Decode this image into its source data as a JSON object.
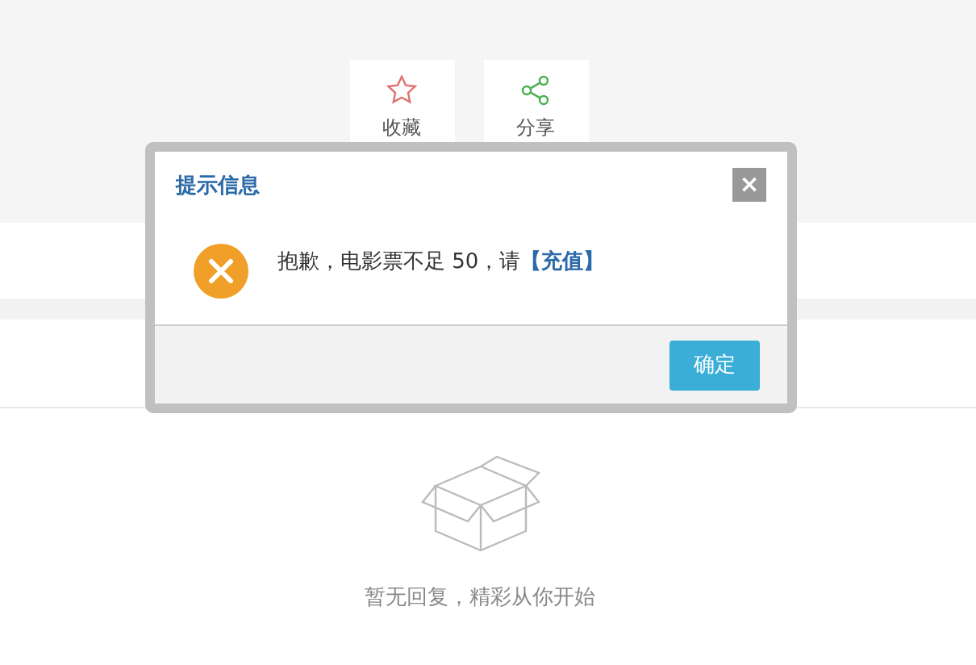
{
  "actions": [
    {
      "kind": "favorite",
      "label": "收藏"
    },
    {
      "kind": "share",
      "label": "分享"
    }
  ],
  "empty_state": {
    "text": "暂无回复，精彩从你开始"
  },
  "dialog": {
    "title": "提示信息",
    "close": "×",
    "message": "抱歉，电影票不足 50，请",
    "link": "【充值】",
    "button": "确定"
  }
}
